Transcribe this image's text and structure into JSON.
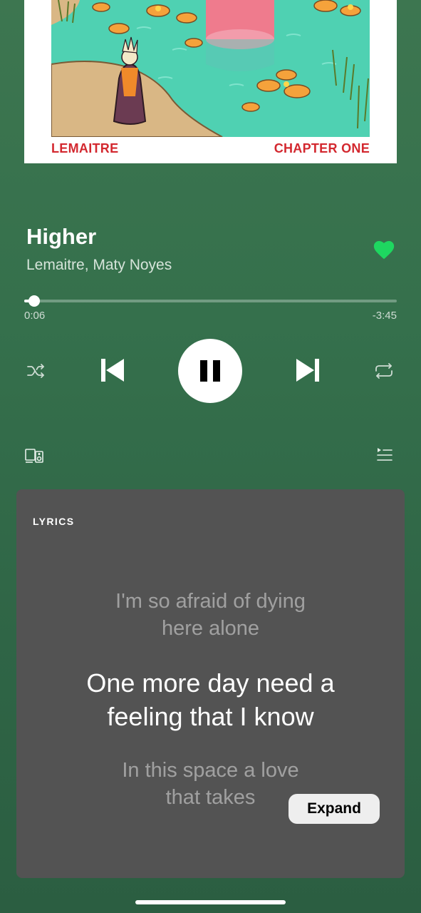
{
  "album": {
    "cover_artist": "LEMAITRE",
    "cover_title": "CHAPTER ONE",
    "cover_text_color": "#d3282f"
  },
  "track": {
    "title": "Higher",
    "artists": "Lemaitre, Maty Noyes",
    "liked": true
  },
  "playback": {
    "elapsed": "0:06",
    "remaining": "-3:45",
    "progress_fraction": 0.026,
    "state": "playing"
  },
  "controls": {
    "shuffle_icon": "shuffle-icon",
    "previous_icon": "skip-previous-icon",
    "play_pause_icon": "pause-icon",
    "next_icon": "skip-next-icon",
    "repeat_icon": "repeat-icon",
    "devices_icon": "devices-icon",
    "queue_icon": "queue-icon"
  },
  "lyrics": {
    "heading": "LYRICS",
    "previous_line_1": "I'm so afraid of dying",
    "previous_line_2": "here alone",
    "current_line_1": "One more day need a",
    "current_line_2": "feeling that I know",
    "next_line_1": "In this space a love",
    "next_line_2": "that takes",
    "expand_label": "Expand"
  },
  "colors": {
    "accent_green": "#1ed760",
    "background_green": "#35704c",
    "lyrics_card": "#535353"
  }
}
